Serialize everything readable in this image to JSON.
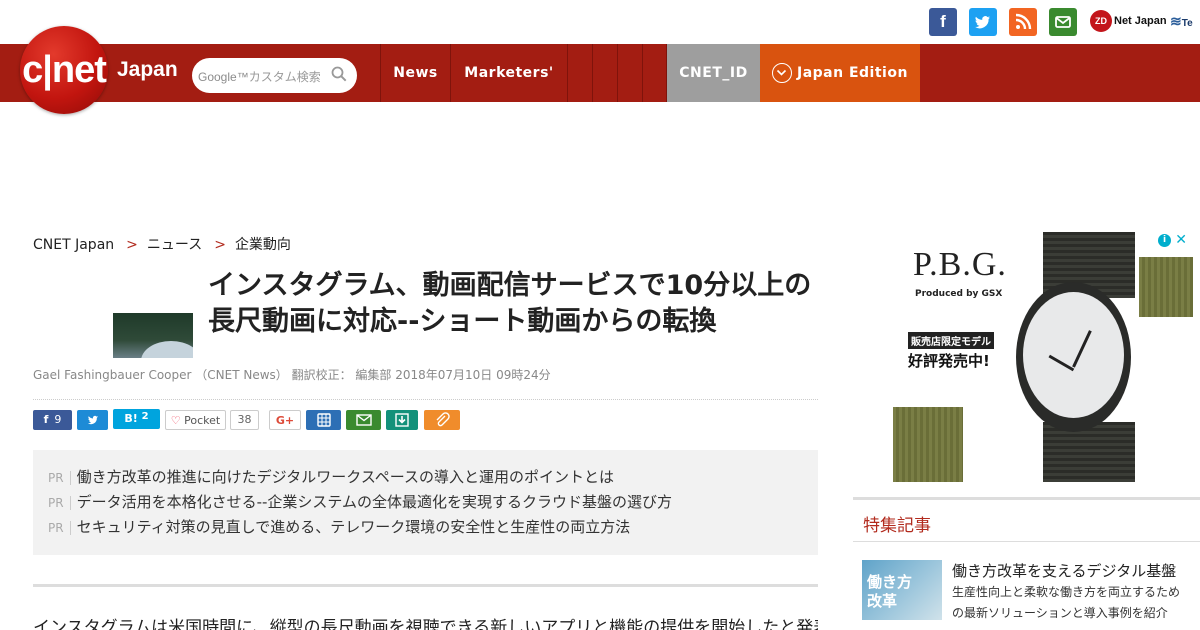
{
  "util": {
    "zdnet": "Net Japan",
    "zd": "ZD",
    "te": "Te"
  },
  "nav": {
    "logo_text": "c|net",
    "logo_sub": "Japan",
    "search_placeholder": "カスタム検索",
    "search_brand": "Google™",
    "items": [
      "News",
      "Marketers'",
      "",
      "",
      "",
      ""
    ],
    "cnetid": "CNET_ID",
    "edition": "Japan Edition"
  },
  "breadcrumb": [
    "CNET Japan",
    "ニュース",
    "企業動向"
  ],
  "article": {
    "title": "インスタグラム、動画配信サービスで10分以上の長尺動画に対応--ショート動画からの転換",
    "byline": "Gael Fashingbauer Cooper （CNET News） 翻訳校正： 編集部 2018年07月10日 09時24分",
    "shares": {
      "facebook": "9",
      "hatena_label": "B!",
      "hatena": "2",
      "pocket_label": "Pocket",
      "pocket": "38",
      "gplus": "G+"
    },
    "pr_label": "PR",
    "pr_items": [
      "働き方改革の推進に向けたデジタルワークスペースの導入と運用のポイントとは",
      "データ活用を本格化させる--企業システムの全体最適化を実現するクラウド基盤の選び方",
      "セキュリティ対策の見直しで進める、テレワーク環境の安全性と生産性の両立方法"
    ],
    "body": "インスタグラムは米国時間に、縦型の長尺動画を視聴できる新しいアプリと機能の提供を開始したと発表した。ユーザーは"
  },
  "ad": {
    "brand": "P.B.G.",
    "produced": "Produced by GSX",
    "limited": "販売店限定モデル",
    "sale": "好評発売中!",
    "info": "i",
    "close": "✕"
  },
  "sidebar": {
    "heading": "特集記事",
    "thumb_text": "働き方\n改革",
    "title": "働き方改革を支えるデジタル基盤",
    "desc": [
      "生産性向上と柔軟な働き方を両立するため",
      "の最新ソリューションと導入事例を紹介"
    ]
  },
  "colors": {
    "nav_red": "#a31d12",
    "logo_red": "#c2150f",
    "cnetid_gray": "#9e9e9e",
    "edition_orange": "#d9530f",
    "facebook": "#3b5998",
    "twitter": "#1da1f2",
    "rss": "#f26522",
    "mail": "#3a8a2f"
  }
}
